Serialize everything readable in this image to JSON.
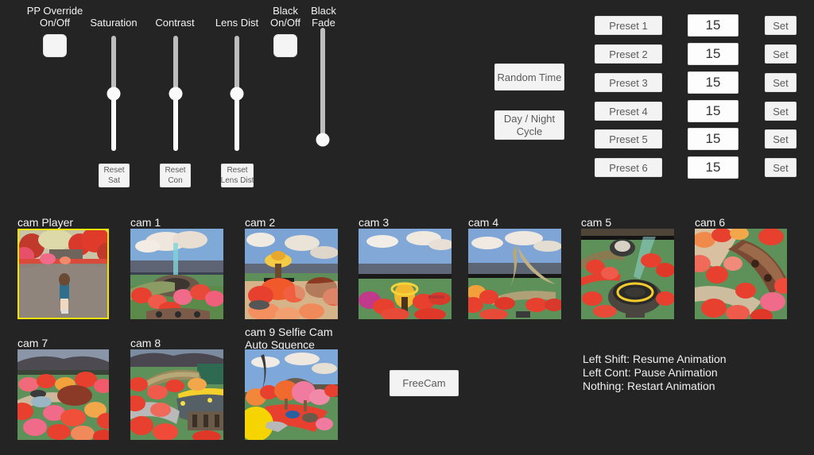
{
  "background_color": "#242424",
  "accent_selected_color": "#f5e300",
  "post_processing": {
    "toggles": [
      {
        "name": "pp-override",
        "label": "PP Override\nOn/Off",
        "state": "off"
      },
      {
        "name": "black-onoff",
        "label": "Black\nOn/Off",
        "state": "off"
      }
    ],
    "sliders": [
      {
        "name": "saturation",
        "label": "Saturation",
        "value_pct": 50,
        "reset_label": "Reset\nSat"
      },
      {
        "name": "contrast",
        "label": "Contrast",
        "value_pct": 50,
        "reset_label": "Reset\nCon"
      },
      {
        "name": "lens-dist",
        "label": "Lens Dist",
        "value_pct": 50,
        "reset_label": "Reset\nLens Dist"
      },
      {
        "name": "black-fade",
        "label": "Black\nFade",
        "value_pct": 3,
        "reset_label": ""
      }
    ]
  },
  "time_controls": {
    "random_time_label": "Random Time",
    "day_night_label": "Day / Night\nCycle",
    "preset_rows": [
      {
        "preset_label": "Preset 1",
        "value": "15",
        "set_label": "Set"
      },
      {
        "preset_label": "Preset 2",
        "value": "15",
        "set_label": "Set"
      },
      {
        "preset_label": "Preset 3",
        "value": "15",
        "set_label": "Set"
      },
      {
        "preset_label": "Preset 4",
        "value": "15",
        "set_label": "Set"
      },
      {
        "preset_label": "Preset 5",
        "value": "15",
        "set_label": "Set"
      },
      {
        "preset_label": "Preset 6",
        "value": "15",
        "set_label": "Set"
      }
    ]
  },
  "cameras": {
    "row1": [
      {
        "id": "player",
        "label": "cam Player",
        "selected": true
      },
      {
        "id": "cam1",
        "label": "cam 1",
        "selected": false
      },
      {
        "id": "cam2",
        "label": "cam 2",
        "selected": false
      },
      {
        "id": "cam3",
        "label": "cam 3",
        "selected": false
      },
      {
        "id": "cam4",
        "label": "cam 4",
        "selected": false
      },
      {
        "id": "cam5",
        "label": "cam 5",
        "selected": false
      },
      {
        "id": "cam6",
        "label": "cam 6",
        "selected": false
      }
    ],
    "row2": [
      {
        "id": "cam7",
        "label": "cam 7",
        "selected": false
      },
      {
        "id": "cam8",
        "label": "cam 8",
        "selected": false
      },
      {
        "id": "cam9",
        "label": "cam 9 Selfie Cam\nAuto Squence",
        "selected": false
      }
    ],
    "freecam_label": "FreeCam"
  },
  "hints": {
    "line1": "Left Shift: Resume Animation",
    "line2": "Left Cont: Pause Animation",
    "line3": "Nothing: Restart Animation"
  }
}
